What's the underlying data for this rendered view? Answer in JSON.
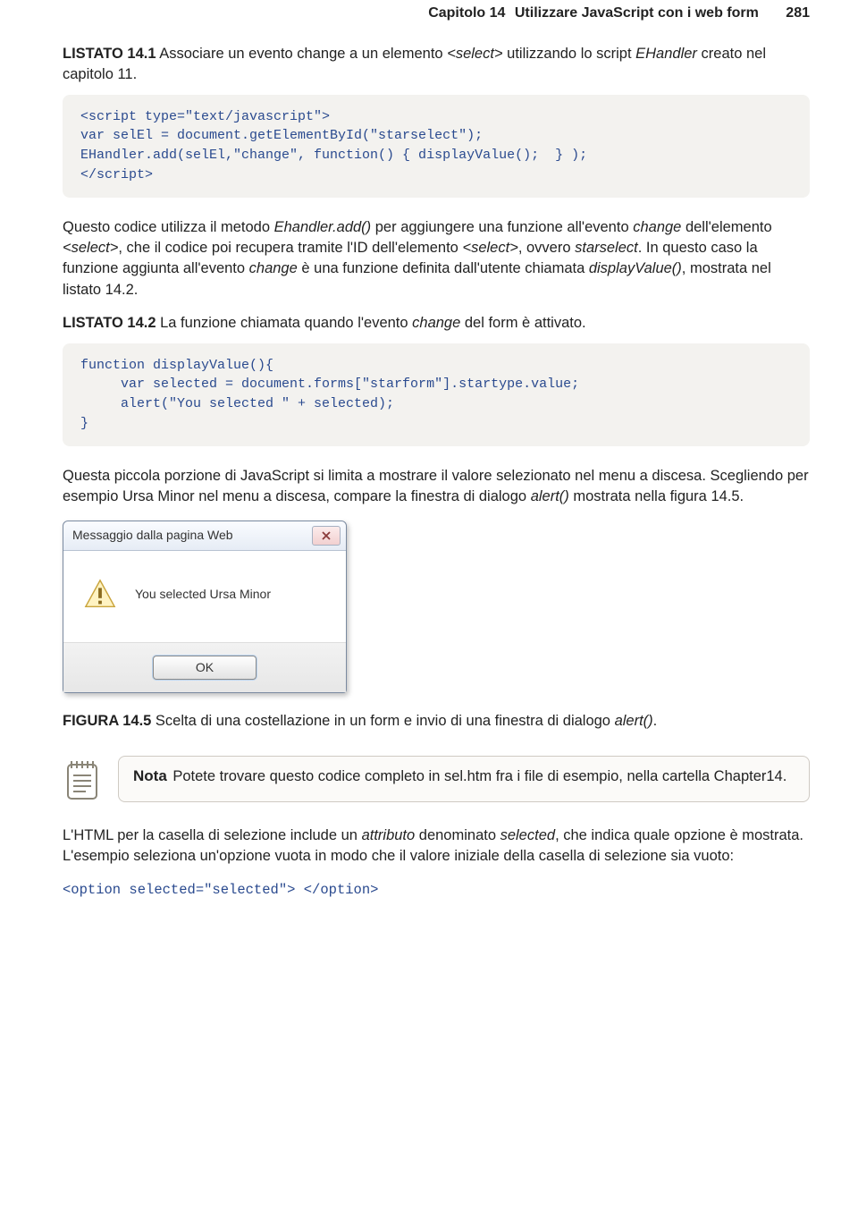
{
  "header": {
    "chapter": "Capitolo 14",
    "title": "Utilizzare JavaScript con i web form",
    "page": "281"
  },
  "listato1": {
    "label": "LISTATO 14.1",
    "caption_prefix": " Associare un evento change a un elemento ",
    "caption_em1": "<select>",
    "caption_mid": " utilizzando lo script ",
    "caption_em2": "EHandler",
    "caption_suffix": " creato nel capitolo 11."
  },
  "code1": "<script type=\"text/javascript\">\nvar selEl = document.getElementById(\"starselect\");\nEHandler.add(selEl,\"change\", function() { displayValue();  } );\n</script>",
  "para1": {
    "t1": "Questo codice utilizza il metodo ",
    "em1": "Ehandler.add()",
    "t2": " per aggiungere una funzione all'evento ",
    "em2": "change",
    "t3": " dell'elemento ",
    "em3": "<select>",
    "t4": ", che il codice poi recupera tramite l'ID dell'elemento ",
    "em4": "<select>",
    "t5": ", ovvero ",
    "em5": "starselect",
    "t6": ". In questo caso la funzione aggiunta all'evento ",
    "em6": "change",
    "t7": " è una funzione definita dall'utente chiamata ",
    "em7": "displayValue()",
    "t8": ", mostrata nel listato 14.2."
  },
  "listato2": {
    "label": "LISTATO 14.2",
    "caption_prefix": " La funzione chiamata quando l'evento ",
    "caption_em": "change",
    "caption_suffix": " del form è attivato."
  },
  "code2": "function displayValue(){\n     var selected = document.forms[\"starform\"].startype.value;\n     alert(\"You selected \" + selected);\n}",
  "para2": {
    "t1": "Questa piccola porzione di JavaScript si limita a mostrare il valore selezionato nel menu a discesa. Scegliendo per esempio Ursa Minor nel menu a discesa, compare la finestra di dialogo ",
    "em1": "alert()",
    "t2": " mostrata nella figura 14.5."
  },
  "dialog": {
    "title": "Messaggio dalla pagina Web",
    "message": "You selected Ursa Minor",
    "ok": "OK"
  },
  "figura": {
    "label": "FIGURA 14.5",
    "caption_prefix": " Scelta di una costellazione in un form e invio di una finestra di dialogo ",
    "caption_em": "alert()",
    "caption_suffix": "."
  },
  "note": {
    "title": "Nota",
    "text": "  Potete trovare questo codice completo in sel.htm fra i file di esempio, nella cartella Chapter14."
  },
  "para3": {
    "t1": "L'HTML per la casella di selezione include un ",
    "em1": "attributo",
    "t2": " denominato ",
    "em2": "selected",
    "t3": ", che indica quale opzione è mostrata. L'esempio seleziona un'opzione vuota in modo che il valore iniziale della casella di selezione sia vuoto:"
  },
  "code3": "<option selected=\"selected\"> </option>"
}
